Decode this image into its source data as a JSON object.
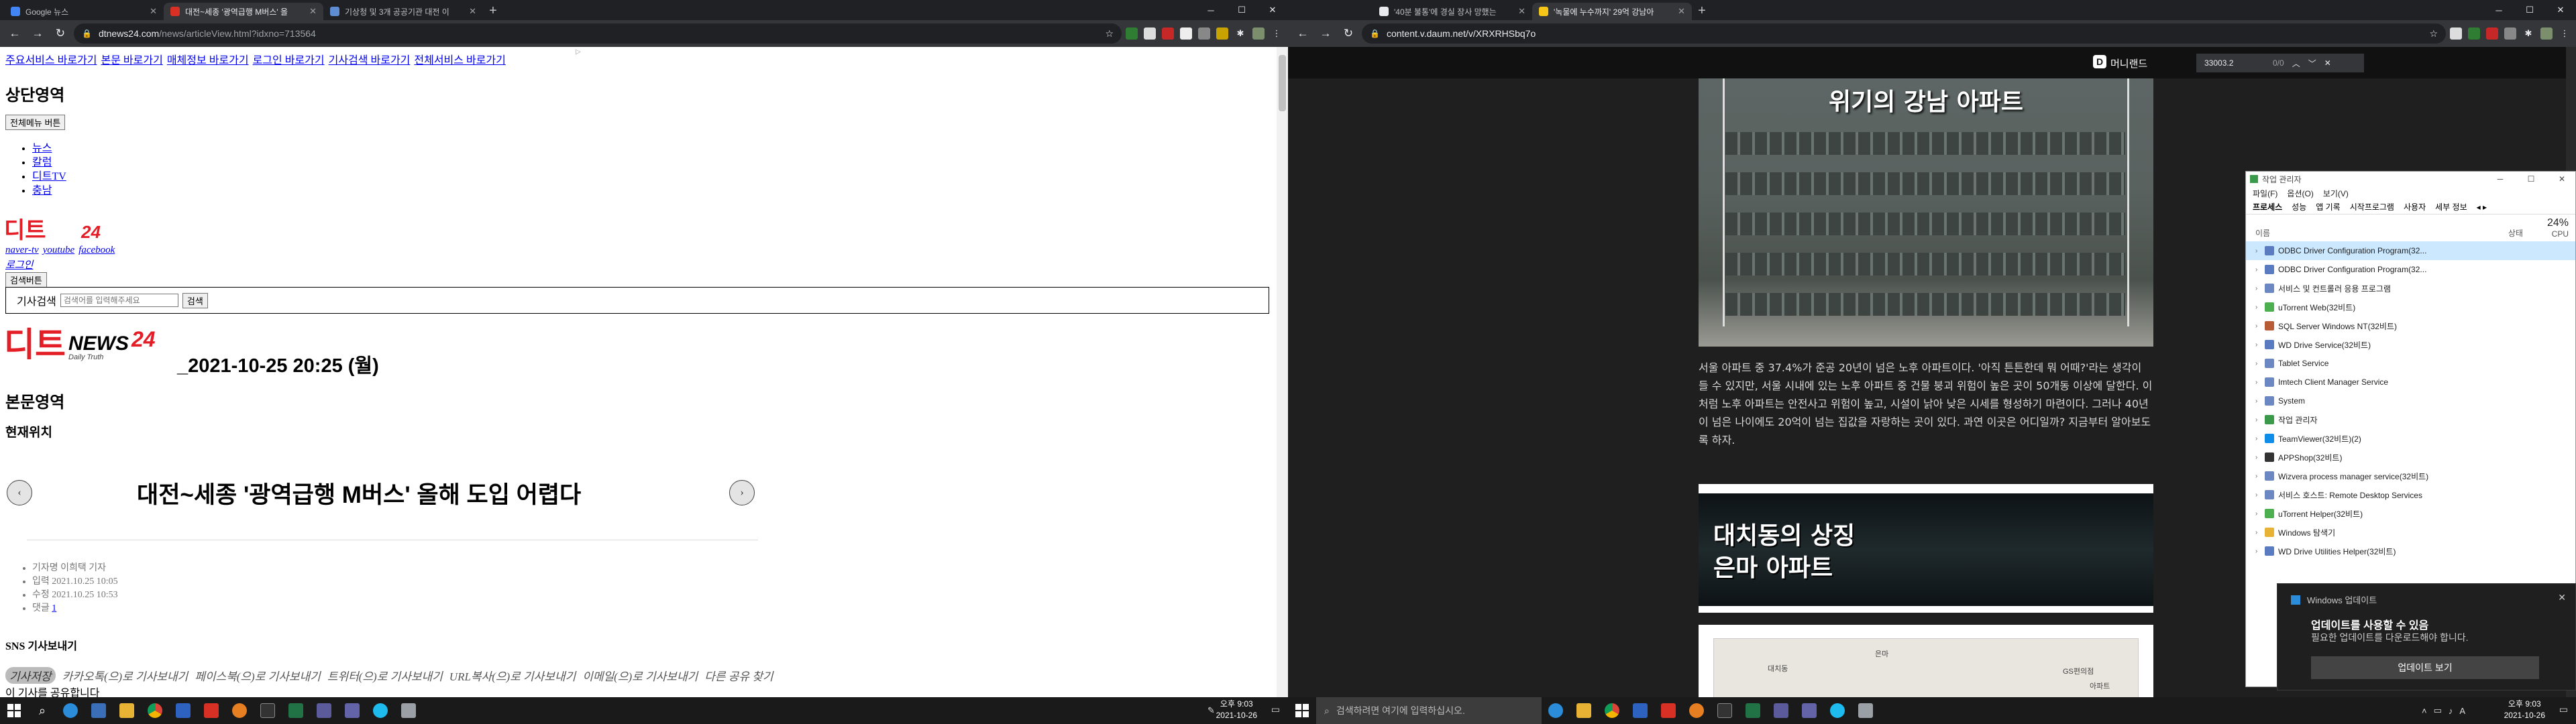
{
  "left_browser": {
    "tabs": [
      {
        "title": "Google 뉴스",
        "color": "#4285f4"
      },
      {
        "title": "대전~세종 '광역급행 M버스' 올",
        "color": "#d93025",
        "active": true
      },
      {
        "title": "기상청 및 3개 공공기관 대전 이",
        "color": "#5f8dd3"
      }
    ],
    "url": "dtnews24.com/news/articleView.html?idxno=713564",
    "url_host": "dtnews24.com",
    "url_path": "/news/articleView.html?idxno=713564"
  },
  "left_page": {
    "skip_links": [
      "주요서비스 바로가기",
      "본문 바로가기",
      "매체정보 바로가기",
      "로그인 바로가기",
      "기사검색 바로가기",
      "전체서비스 바로가기"
    ],
    "top_heading": "상단영역",
    "all_menu_button": "전체메뉴 버튼",
    "nav_links": [
      "뉴스",
      "칼럼",
      "디트TV",
      "충남"
    ],
    "logo_text": "디트",
    "logo_num": "24",
    "social_links": [
      "naver-tv",
      "youtube",
      "facebook"
    ],
    "login_link": "로그인",
    "search_button": "검색버튼",
    "search_label": "기사검색",
    "search_placeholder": "검색어를 입력해주세요",
    "search_submit": "검색",
    "logo2_text": "디트",
    "logo2_news": "NEWS",
    "logo2_num": "24",
    "logo2_tagline": "Daily Truth",
    "date_text": "2021-10-25 20:25 (월)",
    "body_heading": "본문영역",
    "location_heading": "현재위치",
    "article_title": "대전~세종 '광역급행 M버스' 올해 도입 어렵다",
    "meta": [
      "기자명 이희택 기자",
      "입력 2021.10.25 10:05",
      "수정 2021.10.25 10:53",
      "댓글 1"
    ],
    "comment_count": "1",
    "sns_heading": "SNS 기사보내기",
    "sns_items": [
      "기사저장",
      "카카오톡(으)로 기사보내기",
      "페이스북(으)로 기사보내기",
      "트위터(으)로 기사보내기",
      "URL복사(으)로 기사보내기",
      "이메일(으)로 기사보내기",
      "다른 공유 찾기"
    ],
    "share_text": "이 기사를 공유합니다"
  },
  "right_browser": {
    "tabs": [
      {
        "title": "'40분 불통'에 경실 장사 망했는",
        "color": "#e8eaed"
      },
      {
        "title": "'녹물에 누수까지' 29억 강남아",
        "color": "#f5c518",
        "active": true
      }
    ],
    "url": "content.v.daum.net/v/XRXRHSbq7o",
    "find_query": "33003.2",
    "find_count": "0/0"
  },
  "right_page": {
    "brand": "머니랜드",
    "image1_caption": "위기의 강남 아파트",
    "paragraph": "서울 아파트 중 37.4%가 준공 20년이 넘은 노후 아파트이다. '아직 튼튼한데 뭐 어때?'라는 생각이 들 수 있지만, 서울 시내에 있는 노후 아파트 중 건물 붕괴 위험이 높은 곳이 50개동 이상에 달한다. 이처럼 노후 아파트는 안전사고 위험이 높고, 시설이 낡아 낮은 시세를 형성하기 마련이다. 그러나 40년이 넘은 나이에도 20억이 넘는 집값을 자랑하는 곳이 있다. 과연 이곳은 어디일까? 지금부터 알아보도록 하자.",
    "banner_line1": "대치동의 상징",
    "banner_line2": "은마 아파트",
    "map_labels": [
      "대치동",
      "은마",
      "GS편의점",
      "아파트"
    ]
  },
  "task_manager": {
    "title": "작업 관리자",
    "menu": [
      "파일(F)",
      "옵션(O)",
      "보기(V)"
    ],
    "tabs": [
      "프로세스",
      "성능",
      "앱 기록",
      "시작프로그램",
      "사용자",
      "세부 정보"
    ],
    "col_name": "이름",
    "col_status": "상태",
    "cpu_pct": "24%",
    "cpu_label": "CPU",
    "rows": [
      {
        "name": "ODBC Driver Configuration Program(32...",
        "color": "#5a7bbf"
      },
      {
        "name": "ODBC Driver Configuration Program(32...",
        "color": "#5a7bbf"
      },
      {
        "name": "서비스 및 컨트롤러 응용 프로그램",
        "color": "#6b88c2"
      },
      {
        "name": "uTorrent Web(32비트)",
        "color": "#4caf50"
      },
      {
        "name": "SQL Server Windows NT(32비트)",
        "color": "#b85c38"
      },
      {
        "name": "WD Drive Service(32비트)",
        "color": "#5a7bbf"
      },
      {
        "name": "Tablet Service",
        "color": "#6b88c2"
      },
      {
        "name": "Imtech Client Manager Service",
        "color": "#6b88c2"
      },
      {
        "name": "System",
        "color": "#6b88c2"
      },
      {
        "name": "작업 관리자",
        "color": "#3a9a4a"
      },
      {
        "name": "TeamViewer(32비트)(2)",
        "color": "#0e8ee9"
      },
      {
        "name": "APPShop(32비트)",
        "color": "#333333"
      },
      {
        "name": "Wizvera process manager service(32비트)",
        "color": "#6b88c2"
      },
      {
        "name": "서비스 호스트: Remote Desktop Services",
        "color": "#6b88c2"
      },
      {
        "name": "uTorrent Helper(32비트)",
        "color": "#4caf50"
      },
      {
        "name": "Windows 탐색기",
        "color": "#e8b234"
      },
      {
        "name": "WD Drive Utilities Helper(32비트)",
        "color": "#5a7bbf"
      }
    ]
  },
  "notification": {
    "app": "Windows 업데이트",
    "title": "업데이트를 사용할 수 있음",
    "body": "필요한 업데이트를 다운로드해야 합니다.",
    "button": "업데이트 보기"
  },
  "taskbar_left": {
    "time": "오후 9:03",
    "date": "2021-10-26"
  },
  "taskbar_right": {
    "search_placeholder": "검색하려면 여기에 입력하십시오.",
    "time": "오후 9:03",
    "date": "2021-10-26"
  }
}
